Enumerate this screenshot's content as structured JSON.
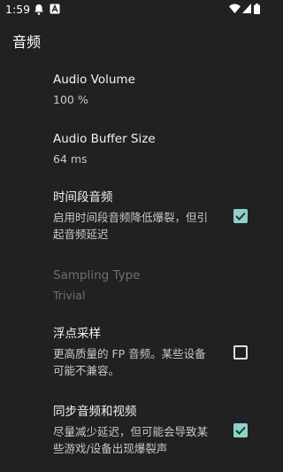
{
  "status_bar": {
    "time": "1:59",
    "left_icons": [
      "bell-icon",
      "notification-a-icon"
    ],
    "right_icons": [
      "wifi-icon",
      "signal-icon",
      "battery-icon"
    ]
  },
  "app_bar": {
    "title": "音频"
  },
  "settings": [
    {
      "title": "Audio Volume",
      "summary": "100 %"
    },
    {
      "title": "Audio Buffer Size",
      "summary": "64 ms"
    },
    {
      "title": "时间段音频",
      "summary": "启用时间段音频降低爆裂，但引起音频延迟",
      "checked": true
    },
    {
      "title": "Sampling Type",
      "summary": "Trivial",
      "enabled": false
    },
    {
      "title": "浮点采样",
      "summary": "更高质量的 FP 音频。某些设备可能不兼容。",
      "checked": false
    },
    {
      "title": "同步音频和视频",
      "summary": "尽量减少延迟，但可能会导致某些游戏/设备出现爆裂声",
      "checked": true
    }
  ],
  "colors": {
    "background": "#212121",
    "accent": "#8fd0c8"
  }
}
